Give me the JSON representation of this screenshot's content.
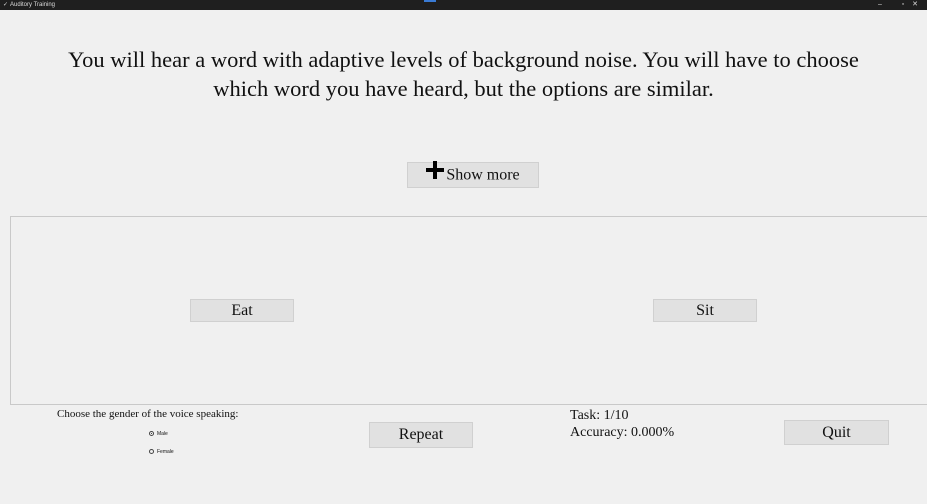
{
  "window": {
    "title": "Auditory Training",
    "app_icon": "feather-icon",
    "controls": {
      "minimize": "–",
      "maximize": "▫",
      "close": "✕"
    }
  },
  "intro": {
    "line1": "You will hear a word with adaptive levels of background noise. You will have to choose",
    "line2": "which word you have heard, but the options are similar."
  },
  "show_more": {
    "icon": "plus-icon",
    "label": "Show more"
  },
  "options": {
    "left": "Eat",
    "right": "Sit"
  },
  "gender": {
    "label": "Choose the gender of the voice speaking:",
    "options": [
      {
        "label": "Male",
        "checked": true
      },
      {
        "label": "Female",
        "checked": false
      }
    ]
  },
  "repeat_label": "Repeat",
  "status": {
    "task": "Task: 1/10",
    "accuracy": "Accuracy: 0.000%"
  },
  "quit_label": "Quit"
}
